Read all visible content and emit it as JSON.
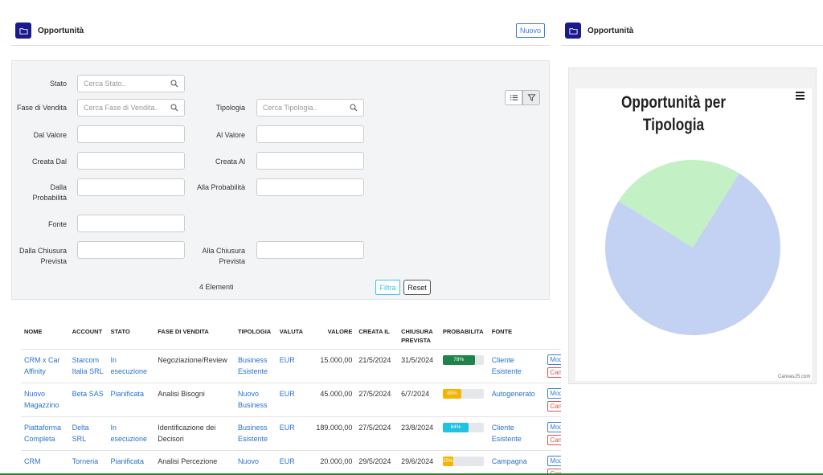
{
  "left_header": {
    "title": "Opportunità",
    "new_button": "Nuovo"
  },
  "right_header": {
    "title": "Opportunità"
  },
  "filters": {
    "stato": {
      "label": "Stato",
      "placeholder": "Cerca Stato.."
    },
    "fase": {
      "label": "Fase di Vendita",
      "placeholder": "Cerca Fase di Vendita.."
    },
    "tipologia": {
      "label": "Tipologia",
      "placeholder": "Cerca Tipologia.."
    },
    "dal_valore": {
      "label": "Dal Valore"
    },
    "al_valore": {
      "label": "Al Valore"
    },
    "creata_dal": {
      "label": "Creata Dal"
    },
    "creata_al": {
      "label": "Creata Al"
    },
    "dalla_prob": {
      "label": "Dalla Probabilità"
    },
    "alla_prob": {
      "label": "Alla Probabilità"
    },
    "fonte": {
      "label": "Fonte"
    },
    "dalla_chiusura": {
      "label": "Dalla Chiusura Prevista"
    },
    "alla_chiusura": {
      "label": "Alla Chiusura Prevista"
    },
    "count": "4  Elementi",
    "filtra": "Filtra",
    "reset": "Reset"
  },
  "table": {
    "headers": {
      "nome": "NOME",
      "account": "ACCOUNT",
      "stato": "STATO",
      "fase": "FASE DI VENDITA",
      "tipologia": "TIPOLOGIA",
      "valuta": "VALUTA",
      "valore": "VALORE",
      "creata": "CREATA IL",
      "chiusura": "CHIUSURA PREVISTA",
      "probabilita": "PROBABILITA",
      "fonte": "FONTE"
    },
    "rows": [
      {
        "nome": "CRM x Car Affinity",
        "account": "Starcom Italia SRL",
        "stato": "In esecuzione",
        "fase": "Negoziazione/Review",
        "tipologia": "Business Esistente",
        "valuta": "EUR",
        "valore": "15.000,00",
        "creata": "21/5/2024",
        "chiusura": "31/5/2024",
        "prob_label": "78%",
        "prob": 78,
        "prob_color": "#1e8449",
        "fonte": "Cliente Esistente",
        "modifica": "Modifica",
        "cancella": "Cancella"
      },
      {
        "nome": "Nuovo Magazzino",
        "account": "Beta SAS",
        "stato": "Pianificata",
        "fase": "Analisi Bisogni",
        "tipologia": "Nuovo Business",
        "valuta": "EUR",
        "valore": "45.000,00",
        "creata": "27/5/2024",
        "chiusura": "6/7/2024",
        "prob_label": "45%",
        "prob": 45,
        "prob_color": "#f4b400",
        "fonte": "Autogenerato",
        "modifica": "Modifica",
        "cancella": "Cancella"
      },
      {
        "nome": "Piattaforma Completa",
        "account": "Delta SRL",
        "stato": "In esecuzione",
        "fase": "Identificazione dei Decisori",
        "tipologia": "Business Esistente",
        "valuta": "EUR",
        "valore": "189.000,00",
        "creata": "27/5/2024",
        "chiusura": "23/8/2024",
        "prob_label": "64%",
        "prob": 64,
        "prob_color": "#1fc2e0",
        "fonte": "Cliente Esistente",
        "modifica": "Modifica",
        "cancella": "Cancella"
      },
      {
        "nome": "CRM",
        "account": "Torneria",
        "stato": "Pianificata",
        "fase": "Analisi Percezione",
        "tipologia": "Nuovo",
        "valuta": "EUR",
        "valore": "20.000,00",
        "creata": "29/5/2024",
        "chiusura": "29/6/2024",
        "prob_label": "25%",
        "prob": 25,
        "prob_color": "#f4b400",
        "fonte": "Campagna",
        "modifica": "Modifica",
        "cancella": "Cancella"
      }
    ]
  },
  "chart_data": {
    "type": "pie",
    "title": "Opportunità per Tipologia",
    "slices": [
      {
        "value": 75,
        "color": "#c3d1f2"
      },
      {
        "value": 25,
        "color": "#c3f0c5"
      }
    ],
    "credit": "CanvasJS.com",
    "menu_icon": "hamburger-icon"
  }
}
